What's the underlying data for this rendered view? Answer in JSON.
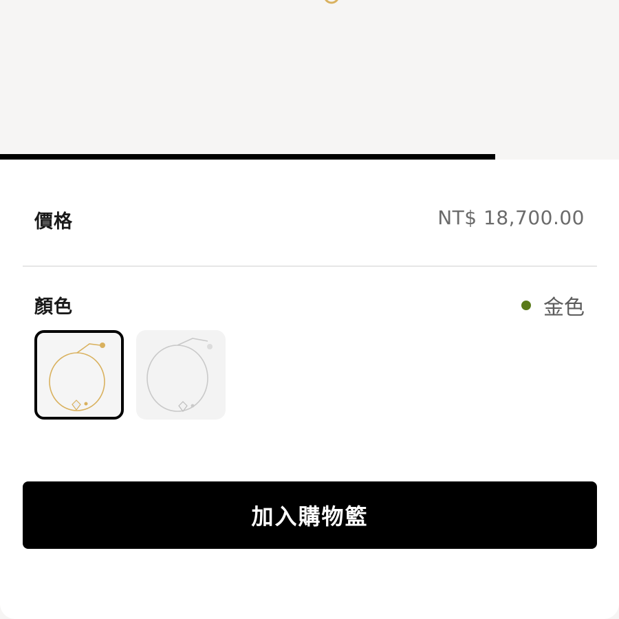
{
  "gallery": {
    "progress_fraction": 0.8
  },
  "price": {
    "label": "價格",
    "value": "NT$ 18,700.00"
  },
  "color": {
    "label": "顏色",
    "selected_name": "金色",
    "selected_dot_color": "#5a7a1a",
    "options": [
      {
        "name": "gold",
        "metal_color": "#d9b15e",
        "selected": true
      },
      {
        "name": "silver",
        "metal_color": "#c9c9c9",
        "selected": false
      }
    ]
  },
  "cta": {
    "label": "加入購物籃"
  },
  "colors": {
    "accent": "#000000",
    "muted_text": "#6b6b6b"
  }
}
